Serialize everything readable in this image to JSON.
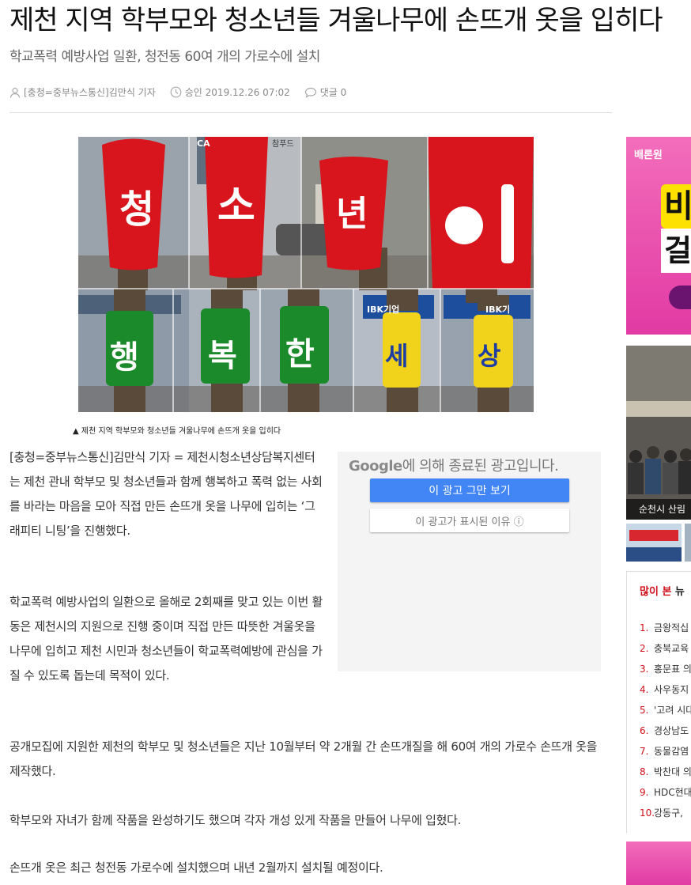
{
  "article": {
    "title": "제천 지역 학부모와 청소년들 겨울나무에 손뜨개 옷을 입히다",
    "subtitle": "학교폭력 예방사업 일환, 청전동 60여 개의 가로수에 설치",
    "author": "[충청=중부뉴스통신]김만식 기자",
    "approved": "승인 2019.12.26 07:02",
    "comments": "댓글 0",
    "caption": "▲ 제천 지역 학부모와 청소년들 겨울나무에 손뜨개 옷을 입히다",
    "paragraphs": [
      "[충청=중부뉴스통신]김만식 기자 = 제천시청소년상담복지센터는 제천 관내 학부모 및 청소년들과 함께 행복하고 폭력 없는 사회를 바라는 마음을 모아 직접 만든 손뜨개 옷을 나무에 입히는 ‘그래피티 니팅’을 진행했다.",
      "학교폭력 예방사업의 일환으로 올해로 2회째를 맞고 있는 이번 활동은 제천시의 지원으로 진행 중이며 직접 만든 따뜻한 겨울옷을 나무에 입히고 제천 시민과 청소년들이 학교폭력예방에 관심을 가질 수 있도록 돕는데 목적이 있다.",
      "공개모집에 지원한 제천의 학부모 및 청소년들은 지난 10월부터 약 2개월 간 손뜨개질을 해 60여 개의 가로수 손뜨개 옷을 제작했다.",
      "학부모와 자녀가 함께 작품을 완성하기도 했으며 각자 개성 있게 작품을 만들어 나무에 입혔다.",
      "손뜨개 옷은 최근 청전동 가로수에 설치했으며 내년 2월까지 설치될 예정이다."
    ]
  },
  "photo": {
    "top_letters": [
      "청",
      "소",
      "년",
      "이"
    ],
    "bottom_letters": [
      "행",
      "복",
      "한",
      "세",
      "상"
    ],
    "signs": [
      "CA",
      "참푸드",
      "IBK기업",
      "IBK기"
    ]
  },
  "ad": {
    "brand": "Google",
    "notice": "에 의해 종료된 광고입니다.",
    "stop_button": "이 광고 그만 보기",
    "why_button": "이 광고가 표시된 이유 ⓘ"
  },
  "sidebar": {
    "ad_brand": "배론원",
    "ad_big1": "비",
    "ad_big2": "걸",
    "news_caption": "순천시 산림",
    "popular_title_red": "많이 본",
    "popular_title_rest": " 뉴",
    "popular": [
      {
        "n": "1.",
        "t": "금왕적십"
      },
      {
        "n": "2.",
        "t": "충북교육"
      },
      {
        "n": "3.",
        "t": "홍문표 의"
      },
      {
        "n": "4.",
        "t": "사우동지"
      },
      {
        "n": "5.",
        "t": "'고려 시대"
      },
      {
        "n": "6.",
        "t": "경상남도"
      },
      {
        "n": "7.",
        "t": "동물감염"
      },
      {
        "n": "8.",
        "t": "박찬대 의"
      },
      {
        "n": "9.",
        "t": "HDC현대"
      },
      {
        "n": "10.",
        "t": "강동구,"
      }
    ]
  },
  "colors": {
    "red_knit": "#d8141c",
    "green_knit": "#1b8a2a",
    "yellow_knit": "#f2d31b",
    "accent_red": "#d0101b",
    "google_blue": "#4285f4"
  }
}
